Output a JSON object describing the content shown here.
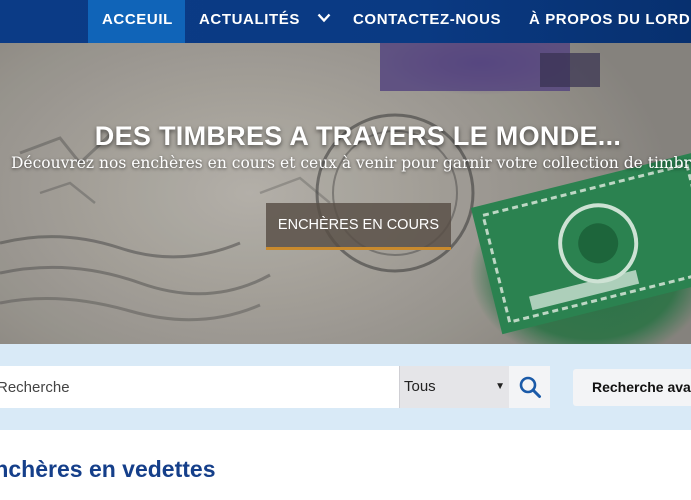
{
  "nav": {
    "items": [
      {
        "label": "ACCEUIL",
        "active": true
      },
      {
        "label": "ACTUALITÉS",
        "has_dropdown": true
      },
      {
        "label": "CONTACTEZ-NOUS"
      },
      {
        "label": "À PROPOS DU LORD"
      }
    ],
    "dropdown_icon": "chevron-down-icon"
  },
  "hero": {
    "title": "DES TIMBRES A TRAVERS LE MONDE...",
    "subtitle": "Découvrez nos enchères en cours et ceux à venir pour garnir votre collection de timbres rares",
    "button_label": "ENCHÈRES EN COURS"
  },
  "search": {
    "placeholder": "Recherche",
    "category_selected": "Tous",
    "search_icon": "search-icon",
    "advanced_label": "Recherche avancée"
  },
  "featured": {
    "title": "Enchères en vedettes"
  },
  "colors": {
    "nav_bg": "#0b3b86",
    "nav_active": "#1064b8",
    "search_band": "#d9eaf7",
    "heading": "#153f8a",
    "button_accent": "#c88a2e"
  }
}
